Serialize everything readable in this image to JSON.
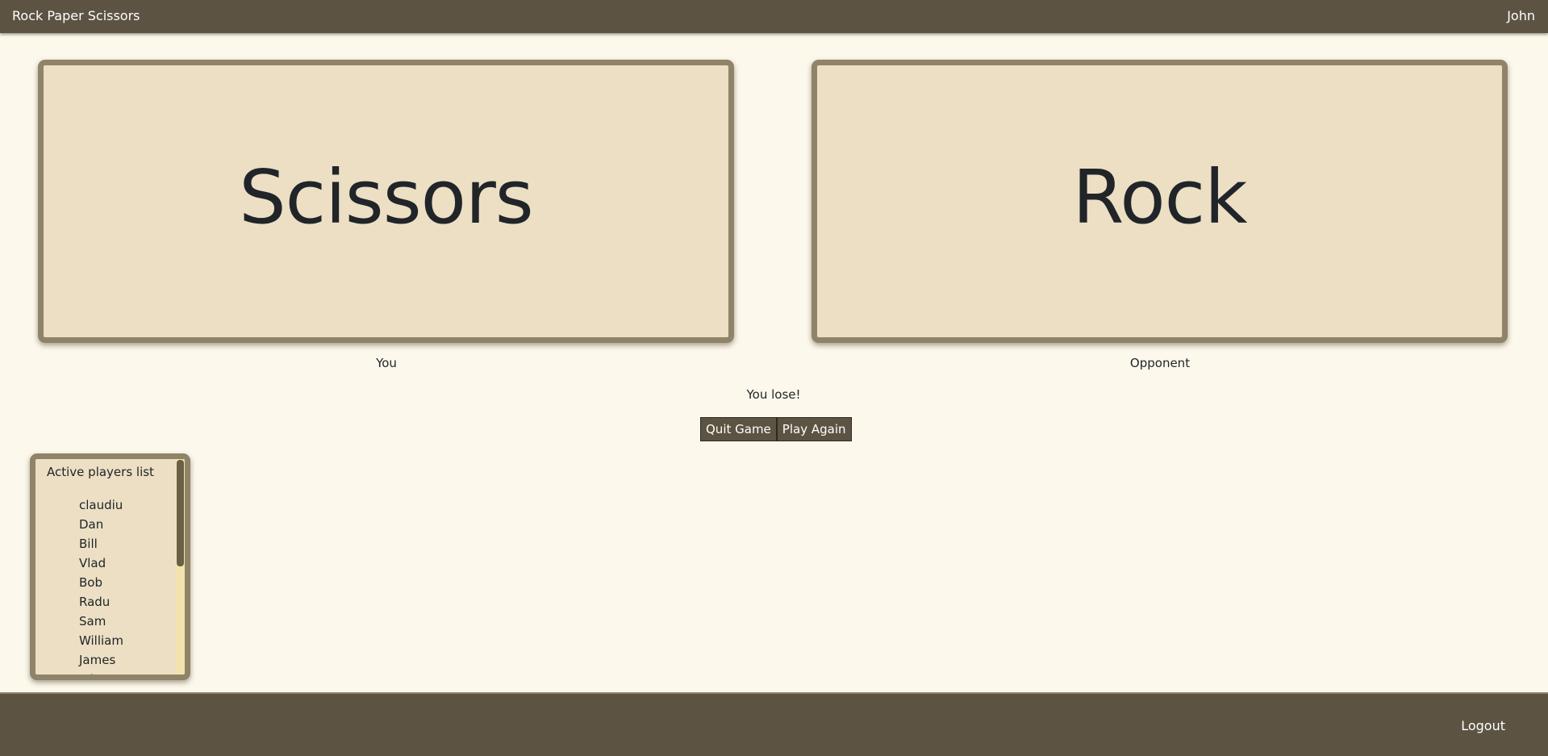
{
  "navbar": {
    "brand": "Rock Paper Scissors",
    "username": "John"
  },
  "game": {
    "you_choice": "Scissors",
    "opponent_choice": "Rock",
    "you_label": "You",
    "opponent_label": "Opponent",
    "result": "You lose!",
    "quit_label": "Quit Game",
    "play_again_label": "Play Again"
  },
  "players": {
    "title": "Active players list",
    "items": [
      "claudiu",
      "Dan",
      "Bill",
      "Vlad",
      "Bob",
      "Radu",
      "Sam",
      "William",
      "James",
      "John"
    ]
  },
  "footer": {
    "logout_label": "Logout"
  },
  "colors": {
    "page_background": "#fdf8ec",
    "bar": "#5c5342",
    "card": "#ecdfc4",
    "card_border": "#8f8368"
  }
}
